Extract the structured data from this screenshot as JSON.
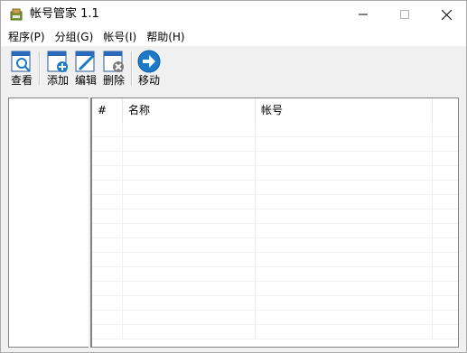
{
  "window": {
    "title": "帐号管家 1.1"
  },
  "titlebar_controls": {
    "minimize_icon": "minimize-icon",
    "maximize_icon": "maximize-icon",
    "close_icon": "close-icon"
  },
  "menu": [
    {
      "label": "程序(P)"
    },
    {
      "label": "分组(G)"
    },
    {
      "label": "帐号(I)"
    },
    {
      "label": "帮助(H)"
    }
  ],
  "toolbar": {
    "view_label": "查看",
    "add_label": "添加",
    "edit_label": "编辑",
    "delete_label": "删除",
    "move_label": "移动"
  },
  "list": {
    "columns": [
      "#",
      "名称",
      "帐号",
      ""
    ],
    "rows": []
  },
  "colors": {
    "accent_blue": "#1e78c8",
    "border": "#828282",
    "chrome": "#f0f0f0"
  }
}
